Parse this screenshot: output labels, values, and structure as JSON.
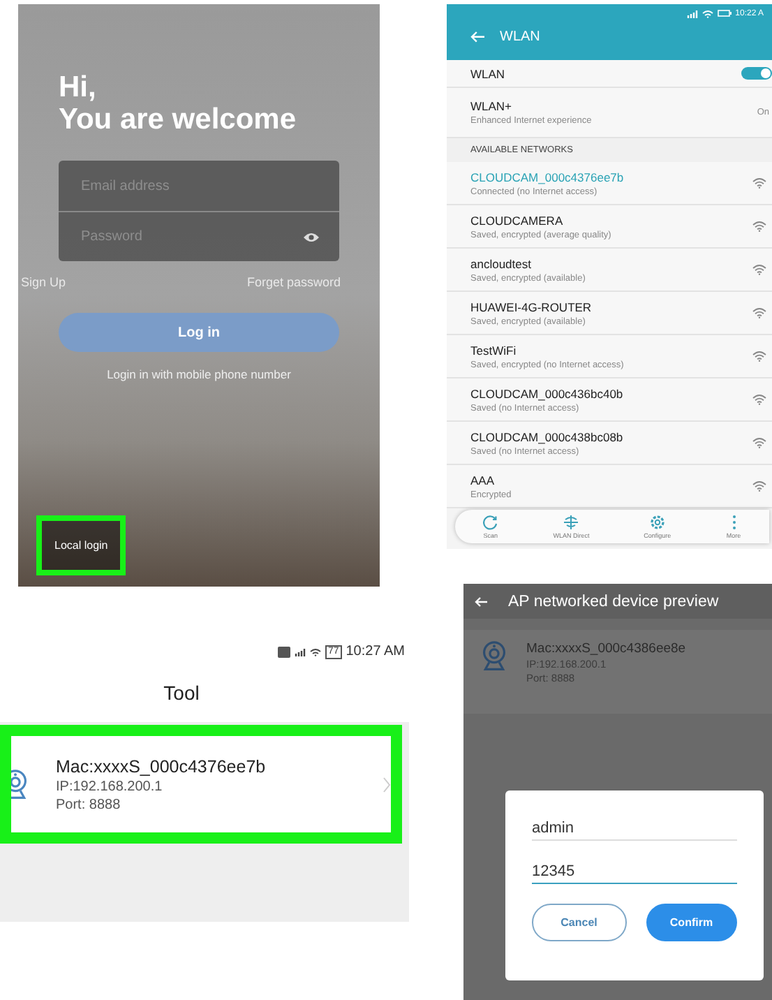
{
  "login_screen": {
    "greeting": [
      "Hi,",
      "You are welcome"
    ],
    "email_field": {
      "placeholder": "Email address"
    },
    "password_field": {
      "placeholder": "Password"
    },
    "sign_up": "Sign Up",
    "forget_password": "Forget password",
    "login_button": "Log in",
    "phone_login": "Login in with mobile phone number",
    "local_login": {
      "label": "Local login",
      "highlighted": true
    }
  },
  "wlan_screen": {
    "status_time": "10:22 A",
    "title": "WLAN",
    "wlan_toggle": {
      "label": "WLAN",
      "on": true
    },
    "wlan_plus": {
      "label": "WLAN+",
      "subtitle": "Enhanced Internet experience",
      "value": "On"
    },
    "section": "AVAILABLE NETWORKS",
    "networks": [
      {
        "name": "CLOUDCAM_000c4376ee7b",
        "status": "Connected (no Internet access)",
        "connected": true
      },
      {
        "name": "CLOUDCAMERA",
        "status": "Saved, encrypted (average quality)",
        "connected": false
      },
      {
        "name": "ancloudtest",
        "status": "Saved, encrypted (available)",
        "connected": false
      },
      {
        "name": "HUAWEI-4G-ROUTER",
        "status": "Saved, encrypted (available)",
        "connected": false
      },
      {
        "name": "TestWiFi",
        "status": "Saved, encrypted (no Internet access)",
        "connected": false
      },
      {
        "name": "CLOUDCAM_000c436bc40b",
        "status": "Saved (no Internet access)",
        "connected": false
      },
      {
        "name": "CLOUDCAM_000c438bc08b",
        "status": "Saved (no Internet access)",
        "connected": false
      },
      {
        "name": "AAA",
        "status": "Encrypted",
        "connected": false
      }
    ],
    "bottom_bar": [
      {
        "kind": "scan",
        "label": "Scan"
      },
      {
        "kind": "direct",
        "label": "WLAN Direct"
      },
      {
        "kind": "configure",
        "label": "Configure"
      },
      {
        "kind": "more",
        "label": "More"
      }
    ]
  },
  "tool_screen": {
    "battery": "77",
    "status_time": "10:27 AM",
    "title": "Tool",
    "device": {
      "mac": "Mac:xxxxS_000c4376ee7b",
      "ip": "IP:192.168.200.1",
      "port": "Port: 8888",
      "highlighted": true
    }
  },
  "preview_screen": {
    "title": "AP networked device preview",
    "device": {
      "mac": "Mac:xxxxS_000c4386ee8e",
      "ip": "IP:192.168.200.1",
      "port": "Port: 8888"
    },
    "dialog": {
      "username": "admin",
      "password": "12345",
      "cancel": "Cancel",
      "confirm": "Confirm"
    }
  }
}
